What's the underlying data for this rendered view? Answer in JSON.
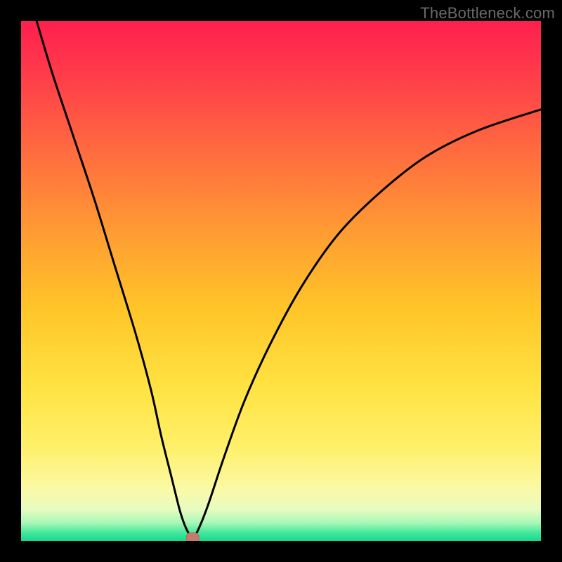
{
  "attribution": "TheBottleneck.com",
  "colors": {
    "frame": "#000000",
    "curve": "#000000",
    "marker_fill": "#c47b6a",
    "marker_stroke": "#b36a5a",
    "gradient_stops": [
      {
        "offset": 0.0,
        "color": "#ff1f4f"
      },
      {
        "offset": 0.1,
        "color": "#ff3b4a"
      },
      {
        "offset": 0.25,
        "color": "#ff6b3f"
      },
      {
        "offset": 0.4,
        "color": "#ff9a33"
      },
      {
        "offset": 0.55,
        "color": "#ffc428"
      },
      {
        "offset": 0.7,
        "color": "#ffe241"
      },
      {
        "offset": 0.82,
        "color": "#fff06a"
      },
      {
        "offset": 0.9,
        "color": "#fbf9a6"
      },
      {
        "offset": 0.94,
        "color": "#e6fcc0"
      },
      {
        "offset": 0.965,
        "color": "#a9f7b6"
      },
      {
        "offset": 0.985,
        "color": "#40e89a"
      },
      {
        "offset": 1.0,
        "color": "#17d890"
      }
    ]
  },
  "chart_data": {
    "type": "line",
    "title": "",
    "xlabel": "",
    "ylabel": "",
    "xlim": [
      0,
      100
    ],
    "ylim": [
      0,
      100
    ],
    "grid": false,
    "legend": false,
    "note": "Values estimated from pixel positions; y expressed as percentage height (0 at bottom, 100 at top).",
    "series": [
      {
        "name": "curve",
        "x": [
          3,
          6,
          10,
          14,
          18,
          22,
          25,
          27,
          29,
          30.5,
          31.5,
          32.5,
          33,
          34,
          36,
          39,
          43,
          48,
          54,
          61,
          69,
          78,
          88,
          100
        ],
        "y": [
          100,
          90,
          78,
          66,
          53,
          40,
          29,
          20,
          12,
          6,
          3,
          1,
          0.6,
          2,
          7,
          16,
          27,
          38,
          49,
          59,
          67,
          74,
          79,
          83
        ]
      }
    ],
    "markers": [
      {
        "name": "minimum-marker",
        "x": 33,
        "y": 0.6,
        "shape": "rounded-rect",
        "color": "#c47b6a"
      }
    ]
  }
}
